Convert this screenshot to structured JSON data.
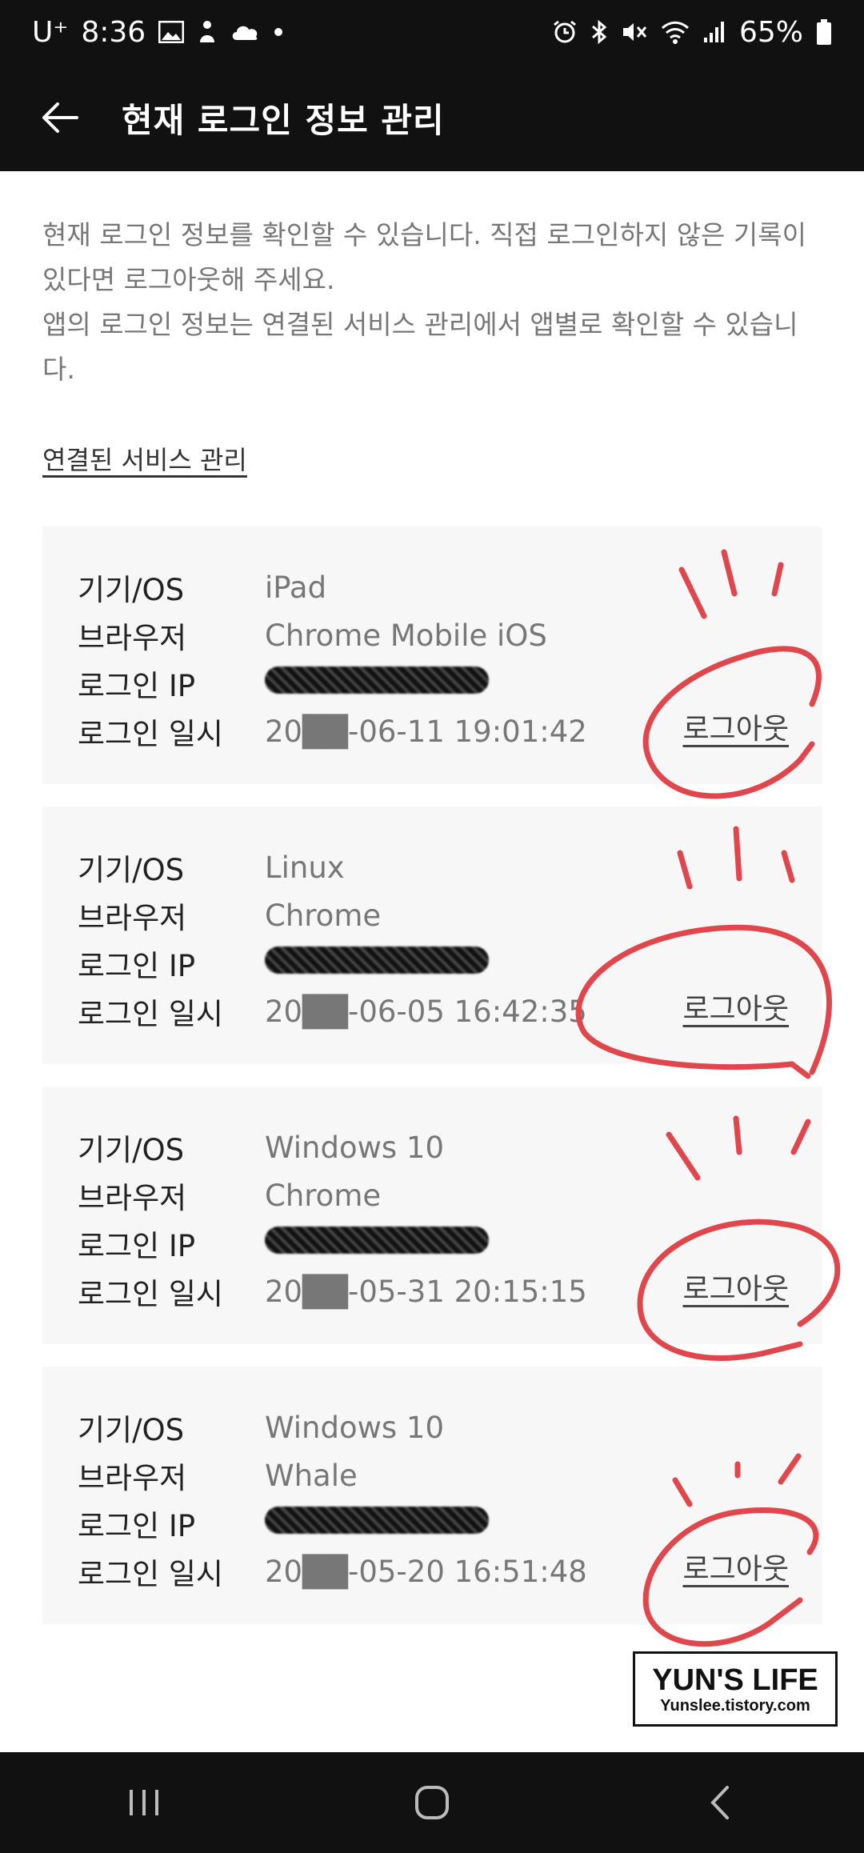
{
  "status_bar": {
    "carrier": "U⁺",
    "time": "8:36",
    "battery": "65%",
    "icons_left": [
      "gallery-icon",
      "notification-icon",
      "cloud-icon",
      "dot-icon"
    ],
    "icons_right": [
      "alarm-icon",
      "bluetooth-icon",
      "mute-icon",
      "wifi-icon",
      "signal-icon",
      "battery-icon"
    ]
  },
  "app_bar": {
    "title": "현재 로그인 정보 관리",
    "back_icon": "back-arrow-icon"
  },
  "description": {
    "line1": "현재 로그인 정보를 확인할 수 있습니다. 직접 로그인하지 않은 기록이 있다면 로그아웃해 주세요.",
    "line2": "앱의 로그인 정보는 연결된 서비스 관리에서 앱별로 확인할 수 있습니다."
  },
  "connected_services_link": "연결된 서비스 관리",
  "labels": {
    "device": "기기/OS",
    "browser": "브라우저",
    "ip": "로그인 IP",
    "datetime": "로그인 일시",
    "logout": "로그아웃"
  },
  "sessions": [
    {
      "device": "iPad",
      "browser": "Chrome Mobile iOS",
      "datetime": "20██-06-11 19:01:42"
    },
    {
      "device": "Linux",
      "browser": "Chrome",
      "datetime": "20██-06-05 16:42:35"
    },
    {
      "device": "Windows 10",
      "browser": "Chrome",
      "datetime": "20██-05-31 20:15:15"
    },
    {
      "device": "Windows 10",
      "browser": "Whale",
      "datetime": "20██-05-20 16:51:48"
    }
  ],
  "watermark": {
    "title": "YUN'S LIFE",
    "subtitle": "Yunslee.tistory.com"
  },
  "colors": {
    "bar_bg": "#111111",
    "card_bg": "#f7f7f7",
    "annotation_red": "#e0474c"
  }
}
